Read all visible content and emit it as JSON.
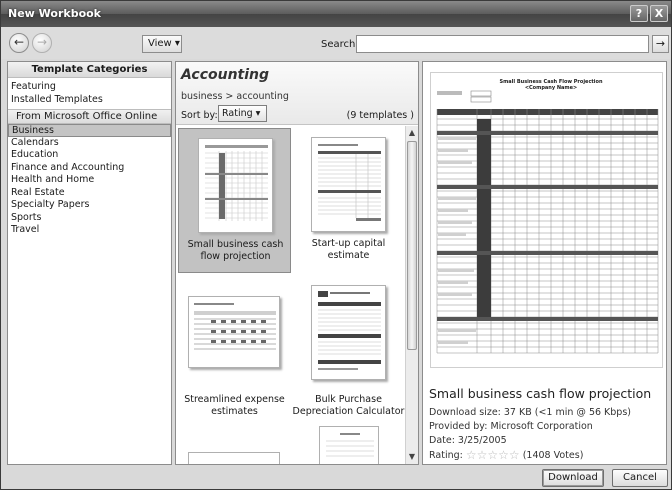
{
  "window": {
    "title": "New Workbook",
    "help_label": "?",
    "close_label": "X"
  },
  "toolbar": {
    "back_icon": "←",
    "forward_icon": "→",
    "view_label": "View ▾",
    "search_label": "Search:",
    "search_value": "",
    "search_go_icon": "→"
  },
  "sidebar": {
    "header": "Template Categories",
    "local_items": [
      "Featuring",
      "Installed Templates"
    ],
    "online_header": "From Microsoft Office Online",
    "online_items": [
      "Business",
      "Calendars",
      "Education",
      "Finance and Accounting",
      "Health and Home",
      "Real Estate",
      "Specialty Papers",
      "Sports",
      "Travel"
    ],
    "selected_index": 0
  },
  "center": {
    "title": "Accounting",
    "breadcrumb": "business > accounting",
    "sort_label": "Sort by:",
    "sort_value": "Rating ▾",
    "count": "(9 templates )",
    "templates": [
      {
        "label_line1": "Small business cash",
        "label_line2": "flow projection"
      },
      {
        "label_line1": "Start-up capital estimate",
        "label_line2": ""
      },
      {
        "label_line1": "Streamlined expense",
        "label_line2": "estimates"
      },
      {
        "label_line1": "Bulk Purchase",
        "label_line2": "Depreciation Calculator"
      }
    ],
    "scroll_up_icon": "▲",
    "scroll_down_icon": "▼"
  },
  "details": {
    "preview_title": "Small Business Cash Flow Projection",
    "preview_subtitle": "<Company Name>",
    "name": "Small business cash flow projection",
    "download_size": "Download size: 37 KB (<1 min @ 56 Kbps)",
    "provided_by": "Provided by: Microsoft Corporation",
    "date": "Date: 3/25/2005",
    "rating_label": "Rating:",
    "rating_stars": "☆☆☆☆☆",
    "votes": "(1408 Votes)"
  },
  "footer": {
    "download_label": "Download",
    "cancel_label": "Cancel"
  }
}
